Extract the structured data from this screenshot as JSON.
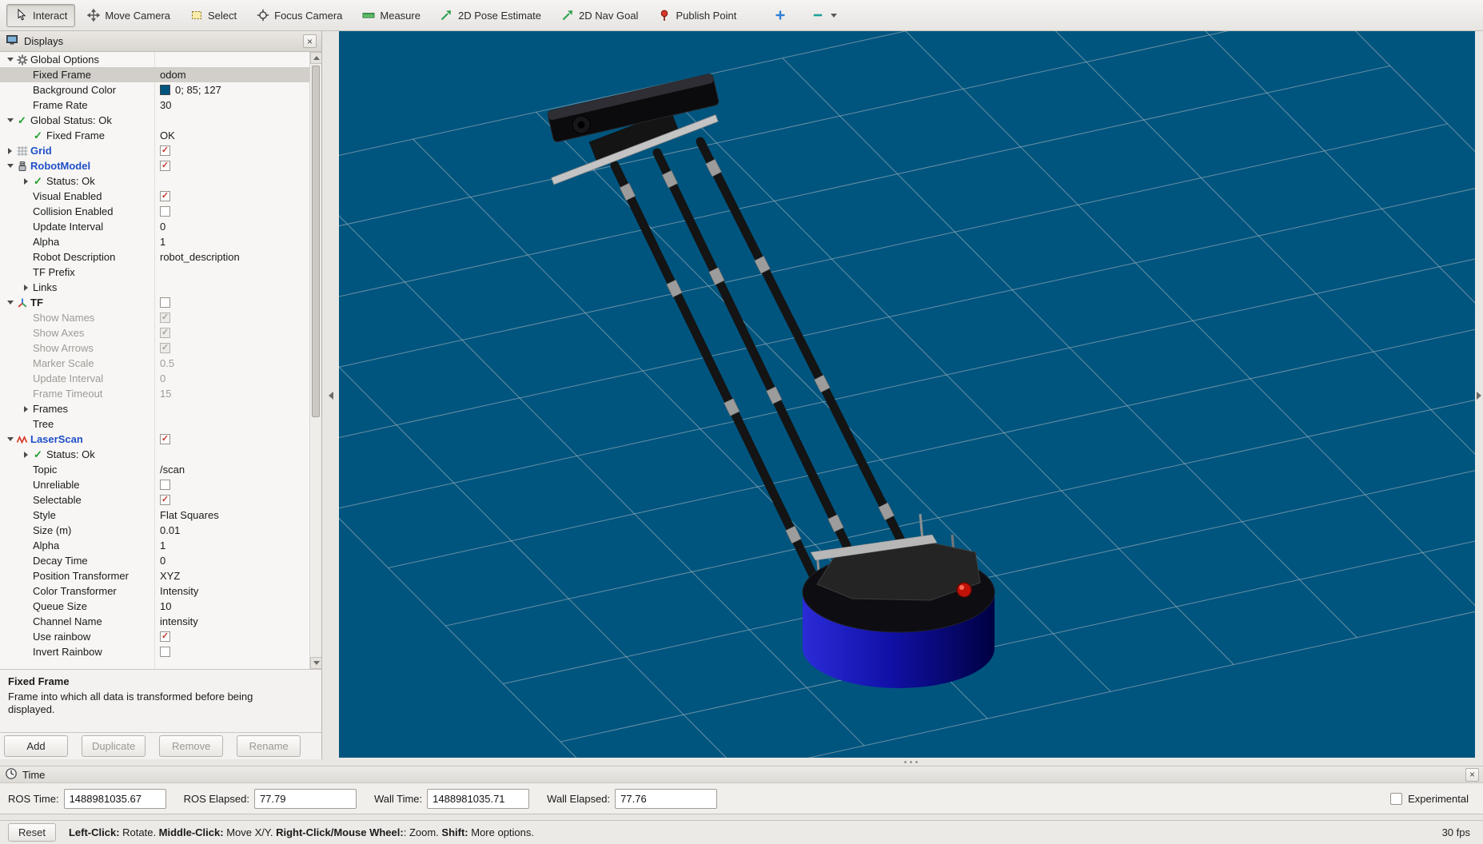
{
  "toolbar": {
    "tools": [
      {
        "label": "Interact",
        "icon": "interact-icon",
        "active": true
      },
      {
        "label": "Move Camera",
        "icon": "move-camera-icon",
        "active": false
      },
      {
        "label": "Select",
        "icon": "select-icon",
        "active": false
      },
      {
        "label": "Focus Camera",
        "icon": "focus-camera-icon",
        "active": false
      },
      {
        "label": "Measure",
        "icon": "measure-icon",
        "active": false
      },
      {
        "label": "2D Pose Estimate",
        "icon": "pose-estimate-icon",
        "active": false
      },
      {
        "label": "2D Nav Goal",
        "icon": "nav-goal-icon",
        "active": false
      },
      {
        "label": "Publish Point",
        "icon": "publish-point-icon",
        "active": false
      }
    ],
    "extras": [
      {
        "name": "add-tool-button",
        "icon": "plus-icon"
      },
      {
        "name": "remove-tool-button",
        "icon": "minus-icon",
        "caret": true
      }
    ]
  },
  "displays_panel": {
    "title": "Displays",
    "rows": [
      {
        "indent": 0,
        "expander": "open",
        "icon": "gear-icon",
        "label": "Global Options"
      },
      {
        "indent": 1,
        "label": "Fixed Frame",
        "value_type": "text",
        "value": "odom",
        "selected": true
      },
      {
        "indent": 1,
        "label": "Background Color",
        "value_type": "color",
        "value": "0; 85; 127",
        "swatch": "#00557f"
      },
      {
        "indent": 1,
        "label": "Frame Rate",
        "value_type": "text",
        "value": "30"
      },
      {
        "indent": 0,
        "expander": "open",
        "icon": "check-icon",
        "label": "Global Status: Ok"
      },
      {
        "indent": 1,
        "icon": "check-icon",
        "label": "Fixed Frame",
        "value_type": "text",
        "value": "OK"
      },
      {
        "indent": 0,
        "expander": "closed",
        "icon": "grid-icon",
        "label": "Grid",
        "style": "display-name",
        "value_type": "checkbox",
        "checked": true
      },
      {
        "indent": 0,
        "expander": "open",
        "icon": "robot-icon",
        "label": "RobotModel",
        "style": "display-name",
        "value_type": "checkbox",
        "checked": true
      },
      {
        "indent": 1,
        "expander": "closed",
        "icon": "check-icon",
        "label": "Status: Ok"
      },
      {
        "indent": 1,
        "label": "Visual Enabled",
        "value_type": "checkbox",
        "checked": true
      },
      {
        "indent": 1,
        "label": "Collision Enabled",
        "value_type": "checkbox",
        "checked": false
      },
      {
        "indent": 1,
        "label": "Update Interval",
        "value_type": "text",
        "value": "0"
      },
      {
        "indent": 1,
        "label": "Alpha",
        "value_type": "text",
        "value": "1"
      },
      {
        "indent": 1,
        "label": "Robot Description",
        "value_type": "text",
        "value": "robot_description"
      },
      {
        "indent": 1,
        "label": "TF Prefix",
        "value_type": "text",
        "value": ""
      },
      {
        "indent": 1,
        "expander": "closed",
        "label": "Links"
      },
      {
        "indent": 0,
        "expander": "open",
        "icon": "tf-icon",
        "label": "TF",
        "style": "display-name-off",
        "value_type": "checkbox",
        "checked": false
      },
      {
        "indent": 1,
        "label": "Show Names",
        "grayed": true,
        "value_type": "checkbox",
        "checked": true
      },
      {
        "indent": 1,
        "label": "Show Axes",
        "grayed": true,
        "value_type": "checkbox",
        "checked": true
      },
      {
        "indent": 1,
        "label": "Show Arrows",
        "grayed": true,
        "value_type": "checkbox",
        "checked": true
      },
      {
        "indent": 1,
        "label": "Marker Scale",
        "grayed": true,
        "value_type": "text",
        "value": "0.5"
      },
      {
        "indent": 1,
        "label": "Update Interval",
        "grayed": true,
        "value_type": "text",
        "value": "0"
      },
      {
        "indent": 1,
        "label": "Frame Timeout",
        "grayed": true,
        "value_type": "text",
        "value": "15"
      },
      {
        "indent": 1,
        "expander": "closed",
        "label": "Frames"
      },
      {
        "indent": 1,
        "label": "Tree"
      },
      {
        "indent": 0,
        "expander": "open",
        "icon": "laser-icon",
        "label": "LaserScan",
        "style": "display-name",
        "value_type": "checkbox",
        "checked": true
      },
      {
        "indent": 1,
        "expander": "closed",
        "icon": "check-icon",
        "label": "Status: Ok"
      },
      {
        "indent": 1,
        "label": "Topic",
        "value_type": "text",
        "value": "/scan"
      },
      {
        "indent": 1,
        "label": "Unreliable",
        "value_type": "checkbox",
        "checked": false
      },
      {
        "indent": 1,
        "label": "Selectable",
        "value_type": "checkbox",
        "checked": true
      },
      {
        "indent": 1,
        "label": "Style",
        "value_type": "text",
        "value": "Flat Squares"
      },
      {
        "indent": 1,
        "label": "Size (m)",
        "value_type": "text",
        "value": "0.01"
      },
      {
        "indent": 1,
        "label": "Alpha",
        "value_type": "text",
        "value": "1"
      },
      {
        "indent": 1,
        "label": "Decay Time",
        "value_type": "text",
        "value": "0"
      },
      {
        "indent": 1,
        "label": "Position Transformer",
        "value_type": "text",
        "value": "XYZ"
      },
      {
        "indent": 1,
        "label": "Color Transformer",
        "value_type": "text",
        "value": "Intensity"
      },
      {
        "indent": 1,
        "label": "Queue Size",
        "value_type": "text",
        "value": "10"
      },
      {
        "indent": 1,
        "label": "Channel Name",
        "value_type": "text",
        "value": "intensity"
      },
      {
        "indent": 1,
        "label": "Use rainbow",
        "value_type": "checkbox",
        "checked": true
      },
      {
        "indent": 1,
        "label": "Invert Rainbow",
        "value_type": "checkbox",
        "checked": false
      }
    ],
    "help": {
      "title": "Fixed Frame",
      "body": "Frame into which all data is transformed before being displayed."
    },
    "buttons": [
      {
        "label": "Add",
        "enabled": true
      },
      {
        "label": "Duplicate",
        "enabled": false
      },
      {
        "label": "Remove",
        "enabled": false
      },
      {
        "label": "Rename",
        "enabled": false
      }
    ]
  },
  "viewport": {
    "background_color": "#00557f",
    "grid_color": "#aeb8be",
    "robot": {
      "base_color": "#1111a8",
      "button_color": "#c01208"
    }
  },
  "time_panel": {
    "title": "Time",
    "fields": [
      {
        "label": "ROS Time:",
        "value": "1488981035.67"
      },
      {
        "label": "ROS Elapsed:",
        "value": "77.79"
      },
      {
        "label": "Wall Time:",
        "value": "1488981035.71"
      },
      {
        "label": "Wall Elapsed:",
        "value": "77.76"
      }
    ],
    "experimental_label": "Experimental"
  },
  "status_bar": {
    "reset_label": "Reset",
    "help_segments": [
      {
        "bold": "Left-Click:",
        "text": " Rotate. "
      },
      {
        "bold": "Middle-Click:",
        "text": " Move X/Y. "
      },
      {
        "bold": "Right-Click/Mouse Wheel:",
        "text": ": Zoom. "
      },
      {
        "bold": "Shift:",
        "text": " More options."
      }
    ],
    "fps": "30 fps"
  }
}
